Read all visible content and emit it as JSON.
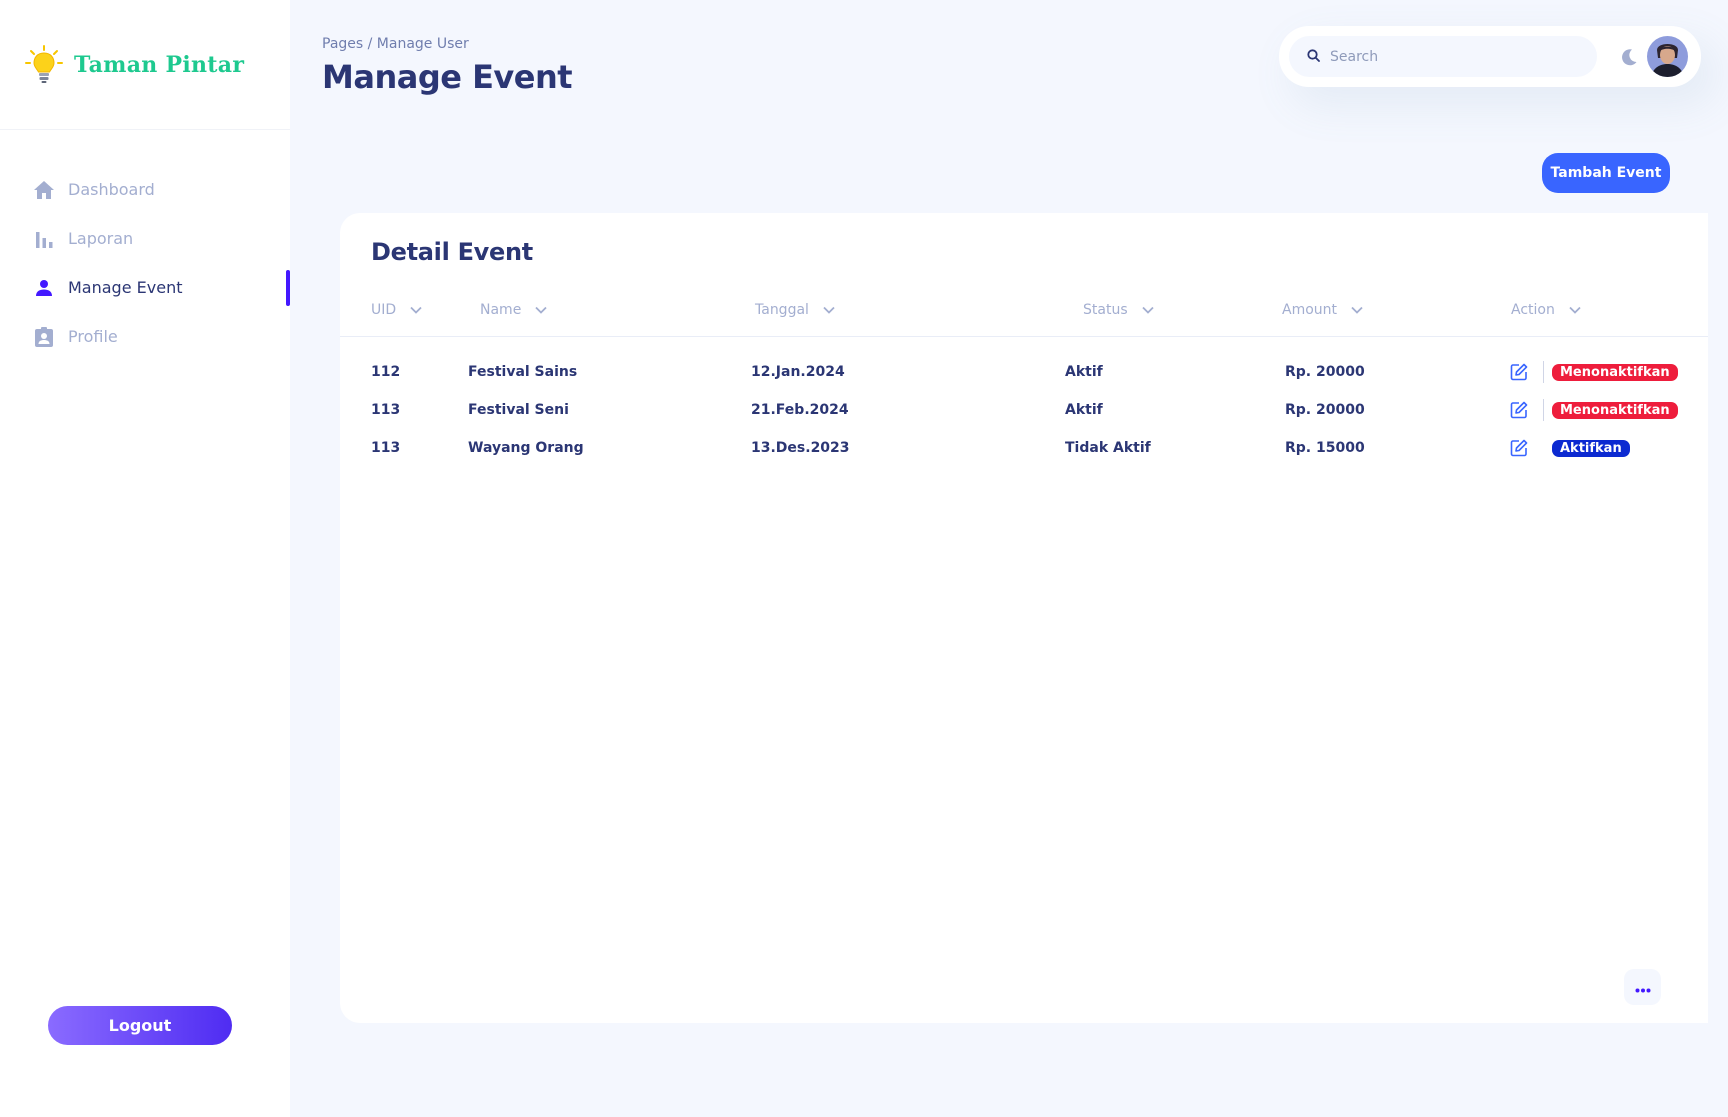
{
  "brand": {
    "name": "Taman Pintar",
    "icon": "lightbulb-icon"
  },
  "sidebar": {
    "items": [
      {
        "label": "Dashboard",
        "icon": "home-icon",
        "active": false
      },
      {
        "label": "Laporan",
        "icon": "bar-chart-icon",
        "active": false
      },
      {
        "label": "Manage Event",
        "icon": "person-icon",
        "active": true
      },
      {
        "label": "Profile",
        "icon": "id-badge-icon",
        "active": false
      }
    ],
    "logout_label": "Logout"
  },
  "header": {
    "breadcrumb": "Pages / Manage User",
    "title": "Manage Event"
  },
  "search": {
    "placeholder": "Search",
    "value": ""
  },
  "actions": {
    "add_label": "Tambah Event"
  },
  "table": {
    "title": "Detail Event",
    "columns": [
      "UID",
      "Name",
      "Tanggal",
      "Status",
      "Amount",
      "Action"
    ],
    "rows": [
      {
        "uid": "112",
        "name": "Festival Sains",
        "tanggal": "12.Jan.2024",
        "status": "Aktif",
        "amount": "Rp. 20000",
        "action": "Menonaktifkan",
        "action_style": "red"
      },
      {
        "uid": "113",
        "name": "Festival Seni",
        "tanggal": "21.Feb.2024",
        "status": "Aktif",
        "amount": "Rp. 20000",
        "action": "Menonaktifkan",
        "action_style": "red"
      },
      {
        "uid": "113",
        "name": "Wayang Orang",
        "tanggal": "13.Des.2023",
        "status": "Tidak Aktif",
        "amount": "Rp. 15000",
        "action": "Aktifkan",
        "action_style": "blue"
      }
    ]
  },
  "colors": {
    "brand_green": "#1ec98f",
    "accent": "#4318ff",
    "primary_button": "#3965ff",
    "danger": "#ee1d3c",
    "activate": "#0c2ad1",
    "text_primary": "#2b3674",
    "text_muted": "#a3aed0"
  }
}
